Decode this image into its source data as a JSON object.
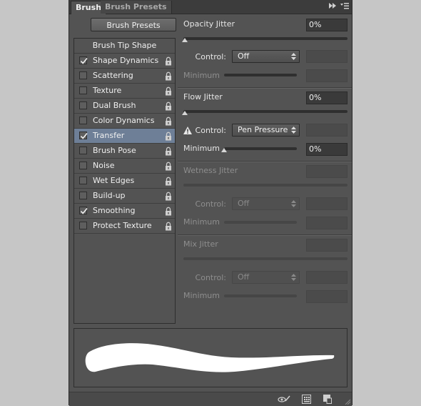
{
  "tabs": [
    {
      "label": "Brush",
      "active": true
    },
    {
      "label": "Brush Presets",
      "active": false
    }
  ],
  "tab_icons": [
    "fast-forward-icon",
    "panel-menu-icon"
  ],
  "presets_button": "Brush Presets",
  "tip_shape_label": "Brush Tip Shape",
  "options": [
    {
      "label": "Shape Dynamics",
      "checked": true,
      "selected": false
    },
    {
      "label": "Scattering",
      "checked": false,
      "selected": false
    },
    {
      "label": "Texture",
      "checked": false,
      "selected": false
    },
    {
      "label": "Dual Brush",
      "checked": false,
      "selected": false
    },
    {
      "label": "Color Dynamics",
      "checked": false,
      "selected": false
    },
    {
      "label": "Transfer",
      "checked": true,
      "selected": true
    },
    {
      "label": "Brush Pose",
      "checked": false,
      "selected": false
    },
    {
      "label": "Noise",
      "checked": false,
      "selected": false
    },
    {
      "label": "Wet Edges",
      "checked": false,
      "selected": false
    },
    {
      "label": "Build-up",
      "checked": false,
      "selected": false
    },
    {
      "label": "Smoothing",
      "checked": true,
      "selected": false
    },
    {
      "label": "Protect Texture",
      "checked": false,
      "selected": false
    }
  ],
  "opacity": {
    "label": "Opacity Jitter",
    "value": "0%",
    "slider": 0,
    "control_label": "Control:",
    "control_value": "Off",
    "minimum_label": "Minimum"
  },
  "flow": {
    "label": "Flow Jitter",
    "value": "0%",
    "slider": 0,
    "control_label": "Control:",
    "control_value": "Pen Pressure",
    "minimum_label": "Minimum",
    "minimum_value": "0%",
    "minimum_slider": 0
  },
  "wetness": {
    "label": "Wetness Jitter",
    "control_label": "Control:",
    "control_value": "Off",
    "minimum_label": "Minimum"
  },
  "mix": {
    "label": "Mix Jitter",
    "control_label": "Control:",
    "control_value": "Off",
    "minimum_label": "Minimum"
  },
  "bottom_icons": [
    "brush-preview-icon",
    "toggle-grid-icon",
    "new-preset-icon"
  ],
  "colors": {
    "panel": "#535353",
    "selected_row": "#6e7f97",
    "stroke": "#ffffff"
  }
}
